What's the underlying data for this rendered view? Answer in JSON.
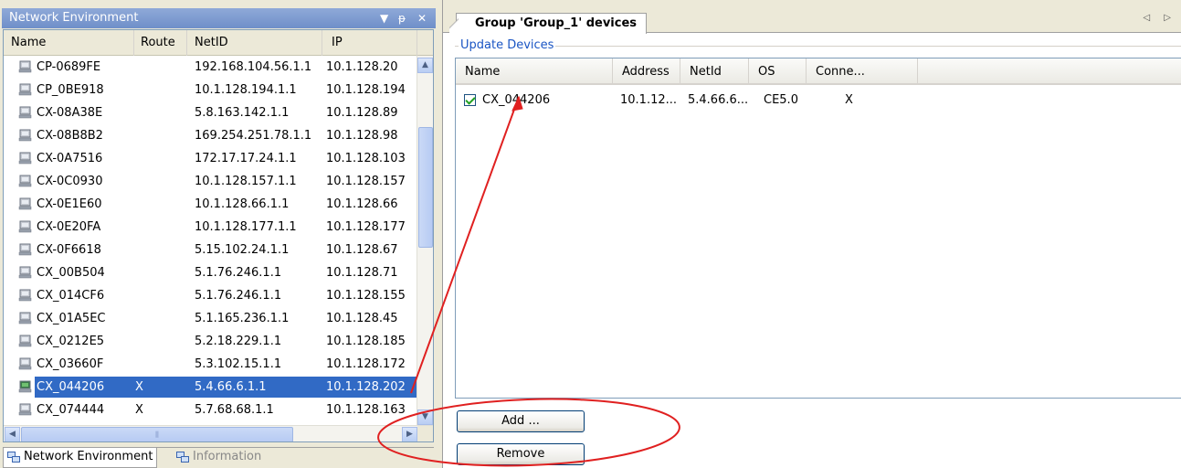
{
  "left_panel": {
    "title": "Network Environment",
    "title_controls": {
      "dropdown": "▼",
      "pin": "ᵽ",
      "close": "✕"
    },
    "columns": [
      "Name",
      "Route",
      "NetID",
      "IP"
    ],
    "rows": [
      {
        "name": "CP-0689FE",
        "route": "",
        "netid": "192.168.104.56.1.1",
        "ip": "10.1.128.20"
      },
      {
        "name": "CP_0BE918",
        "route": "",
        "netid": "10.1.128.194.1.1",
        "ip": "10.1.128.194"
      },
      {
        "name": "CX-08A38E",
        "route": "",
        "netid": "5.8.163.142.1.1",
        "ip": "10.1.128.89"
      },
      {
        "name": "CX-08B8B2",
        "route": "",
        "netid": "169.254.251.78.1.1",
        "ip": "10.1.128.98"
      },
      {
        "name": "CX-0A7516",
        "route": "",
        "netid": "172.17.17.24.1.1",
        "ip": "10.1.128.103"
      },
      {
        "name": "CX-0C0930",
        "route": "",
        "netid": "10.1.128.157.1.1",
        "ip": "10.1.128.157"
      },
      {
        "name": "CX-0E1E60",
        "route": "",
        "netid": "10.1.128.66.1.1",
        "ip": "10.1.128.66"
      },
      {
        "name": "CX-0E20FA",
        "route": "",
        "netid": "10.1.128.177.1.1",
        "ip": "10.1.128.177"
      },
      {
        "name": "CX-0F6618",
        "route": "",
        "netid": "5.15.102.24.1.1",
        "ip": "10.1.128.67"
      },
      {
        "name": "CX_00B504",
        "route": "",
        "netid": "5.1.76.246.1.1",
        "ip": "10.1.128.71"
      },
      {
        "name": "CX_014CF6",
        "route": "",
        "netid": "5.1.76.246.1.1",
        "ip": "10.1.128.155"
      },
      {
        "name": "CX_01A5EC",
        "route": "",
        "netid": "5.1.165.236.1.1",
        "ip": "10.1.128.45"
      },
      {
        "name": "CX_0212E5",
        "route": "",
        "netid": "5.2.18.229.1.1",
        "ip": "10.1.128.185"
      },
      {
        "name": "CX_03660F",
        "route": "",
        "netid": "5.3.102.15.1.1",
        "ip": "10.1.128.172"
      },
      {
        "name": "CX_044206",
        "route": "X",
        "netid": "5.4.66.6.1.1",
        "ip": "10.1.128.202",
        "selected": true
      },
      {
        "name": "CX_074444",
        "route": "X",
        "netid": "5.7.68.68.1.1",
        "ip": "10.1.128.163"
      }
    ],
    "bottom_tabs": [
      "Network Environment",
      "Information"
    ]
  },
  "right_panel": {
    "tab_title": "Group 'Group_1' devices",
    "tab_nav": "◁ ▷",
    "section_label": "Update Devices",
    "columns": [
      "Name",
      "Address",
      "NetId",
      "OS",
      "Conne..."
    ],
    "devices": [
      {
        "checked": true,
        "name": "CX_044206",
        "address": "10.1.12...",
        "netid": "5.4.66.6...",
        "os": "CE5.0",
        "connected": "X"
      }
    ],
    "buttons": {
      "add": "Add ...",
      "remove": "Remove"
    }
  },
  "colors": {
    "title_bar": "#7b97cf",
    "selection": "#316ac5",
    "annotation": "#e02020",
    "legend_text": "#1a55c4"
  }
}
